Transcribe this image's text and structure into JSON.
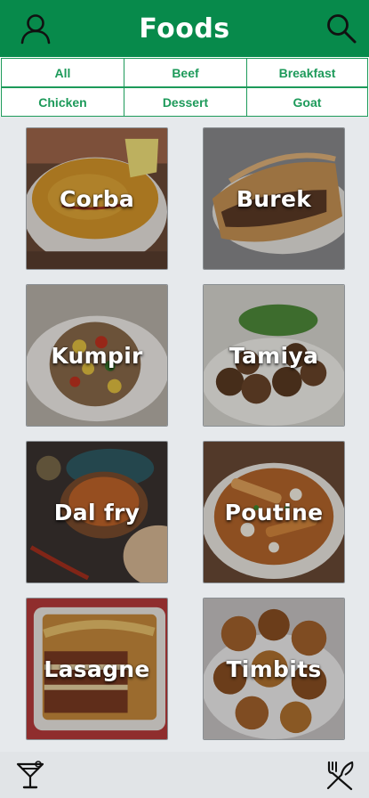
{
  "header": {
    "title": "Foods",
    "background_color": "#078a4b",
    "left_icon": "user-icon",
    "right_icon": "search-icon"
  },
  "tabs": [
    {
      "label": "All"
    },
    {
      "label": "Beef"
    },
    {
      "label": "Breakfast"
    },
    {
      "label": "Chicken"
    },
    {
      "label": "Dessert"
    },
    {
      "label": "Goat"
    }
  ],
  "foods": [
    {
      "name": "Corba"
    },
    {
      "name": "Burek"
    },
    {
      "name": "Kumpir"
    },
    {
      "name": "Tamiya"
    },
    {
      "name": "Dal fry"
    },
    {
      "name": "Poutine"
    },
    {
      "name": "Lasagne"
    },
    {
      "name": "Timbits"
    }
  ],
  "bottom_nav": {
    "left_icon": "cocktail-icon",
    "right_icon": "fork-knife-icon"
  },
  "colors": {
    "accent": "#078a4b",
    "tab_text": "#1d9a5a",
    "background": "#e6e9ec"
  }
}
